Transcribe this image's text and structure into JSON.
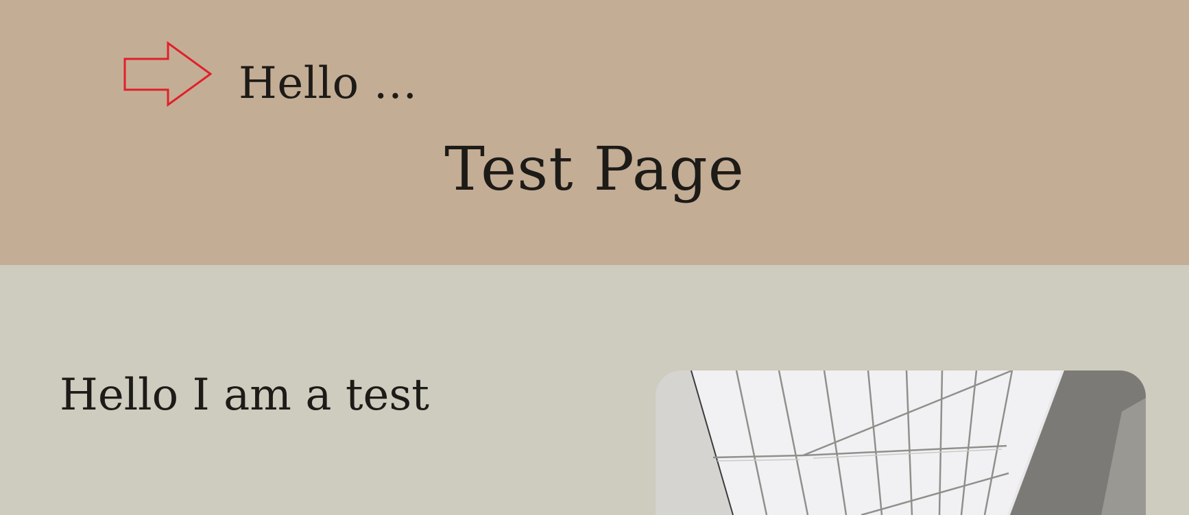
{
  "header": {
    "greeting": "Hello …",
    "title": "Test Page",
    "icon": "arrow-right-icon",
    "background": "#c4ad95",
    "arrow_color": "#e0202a"
  },
  "main": {
    "heading": "Hello I am a test",
    "background": "#cecbbf",
    "image": "architectural-skylight-photo"
  }
}
